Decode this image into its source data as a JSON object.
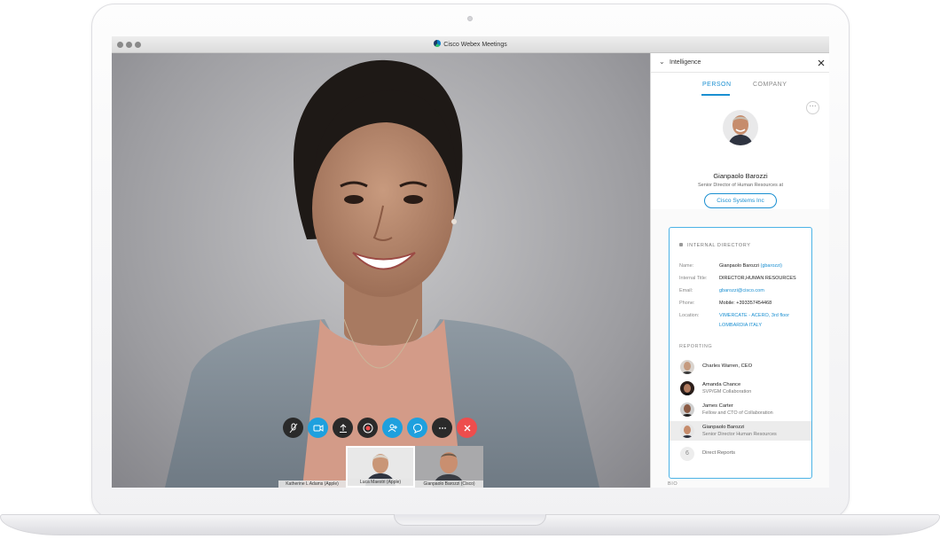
{
  "window": {
    "title": "Cisco Webex Meetings"
  },
  "controls": [
    {
      "name": "mute-button",
      "icon": "microphone-muted-icon",
      "style": "dark"
    },
    {
      "name": "video-button",
      "icon": "video-camera-icon",
      "style": "blue"
    },
    {
      "name": "share-button",
      "icon": "share-upload-icon",
      "style": "dark"
    },
    {
      "name": "record-button",
      "icon": "record-icon",
      "style": "dark"
    },
    {
      "name": "participants-button",
      "icon": "participants-icon",
      "style": "blue"
    },
    {
      "name": "chat-button",
      "icon": "chat-bubble-icon",
      "style": "blue"
    },
    {
      "name": "more-options-button",
      "icon": "ellipsis-icon",
      "style": "dark"
    },
    {
      "name": "end-call-button",
      "icon": "close-icon",
      "style": "red"
    }
  ],
  "thumbnails": [
    {
      "caption": "Katherine L Adams (Apple)"
    },
    {
      "caption": "Luca Maestri (Apple)"
    },
    {
      "caption": "Gianpaolo Barozzi (Cisco)"
    }
  ],
  "panel": {
    "title": "Intelligence",
    "tabs": {
      "person": "PERSON",
      "company": "COMPANY"
    },
    "more_label": "···",
    "person": {
      "name": "Gianpaolo Barozzi",
      "role": "Senior Director of Human Resources at",
      "company_button": "Cisco Systems Inc"
    },
    "directory": {
      "heading": "INTERNAL DIRECTORY",
      "labels": {
        "name": "Name:",
        "title": "Internal Title:",
        "email": "Email:",
        "phone": "Phone:",
        "location": "Location:"
      },
      "values": {
        "name": "Gianpaolo Barozzi",
        "handle": "(gbarozzi)",
        "title": "DIRECTOR,HUMAN RESOURCES",
        "email": "gbarozzi@cisco.com",
        "phone": "Mobile: +393357454468",
        "location_line1": "VIMERCATE - ACERO, 3rd floor",
        "location_line2": "LOMBARDIA  ITALY"
      },
      "reporting_heading": "REPORTING",
      "reporting": [
        {
          "name": "Charles Warren, CEO",
          "title": ""
        },
        {
          "name": "Amanda Chance",
          "title": "SVP/GM Collaboration"
        },
        {
          "name": "James Carter",
          "title": "Fellow and CTO of Collaboration"
        },
        {
          "name": "Gianpaolo Barozzi",
          "title": "Senior Director Human Resources"
        }
      ],
      "direct_reports_count": "6",
      "direct_reports_label": "Direct Reports"
    },
    "bio_label": "BIO"
  },
  "colors": {
    "accent": "#1a8fd1",
    "end_call": "#ee4d4d",
    "control_blue": "#1ea0de"
  }
}
